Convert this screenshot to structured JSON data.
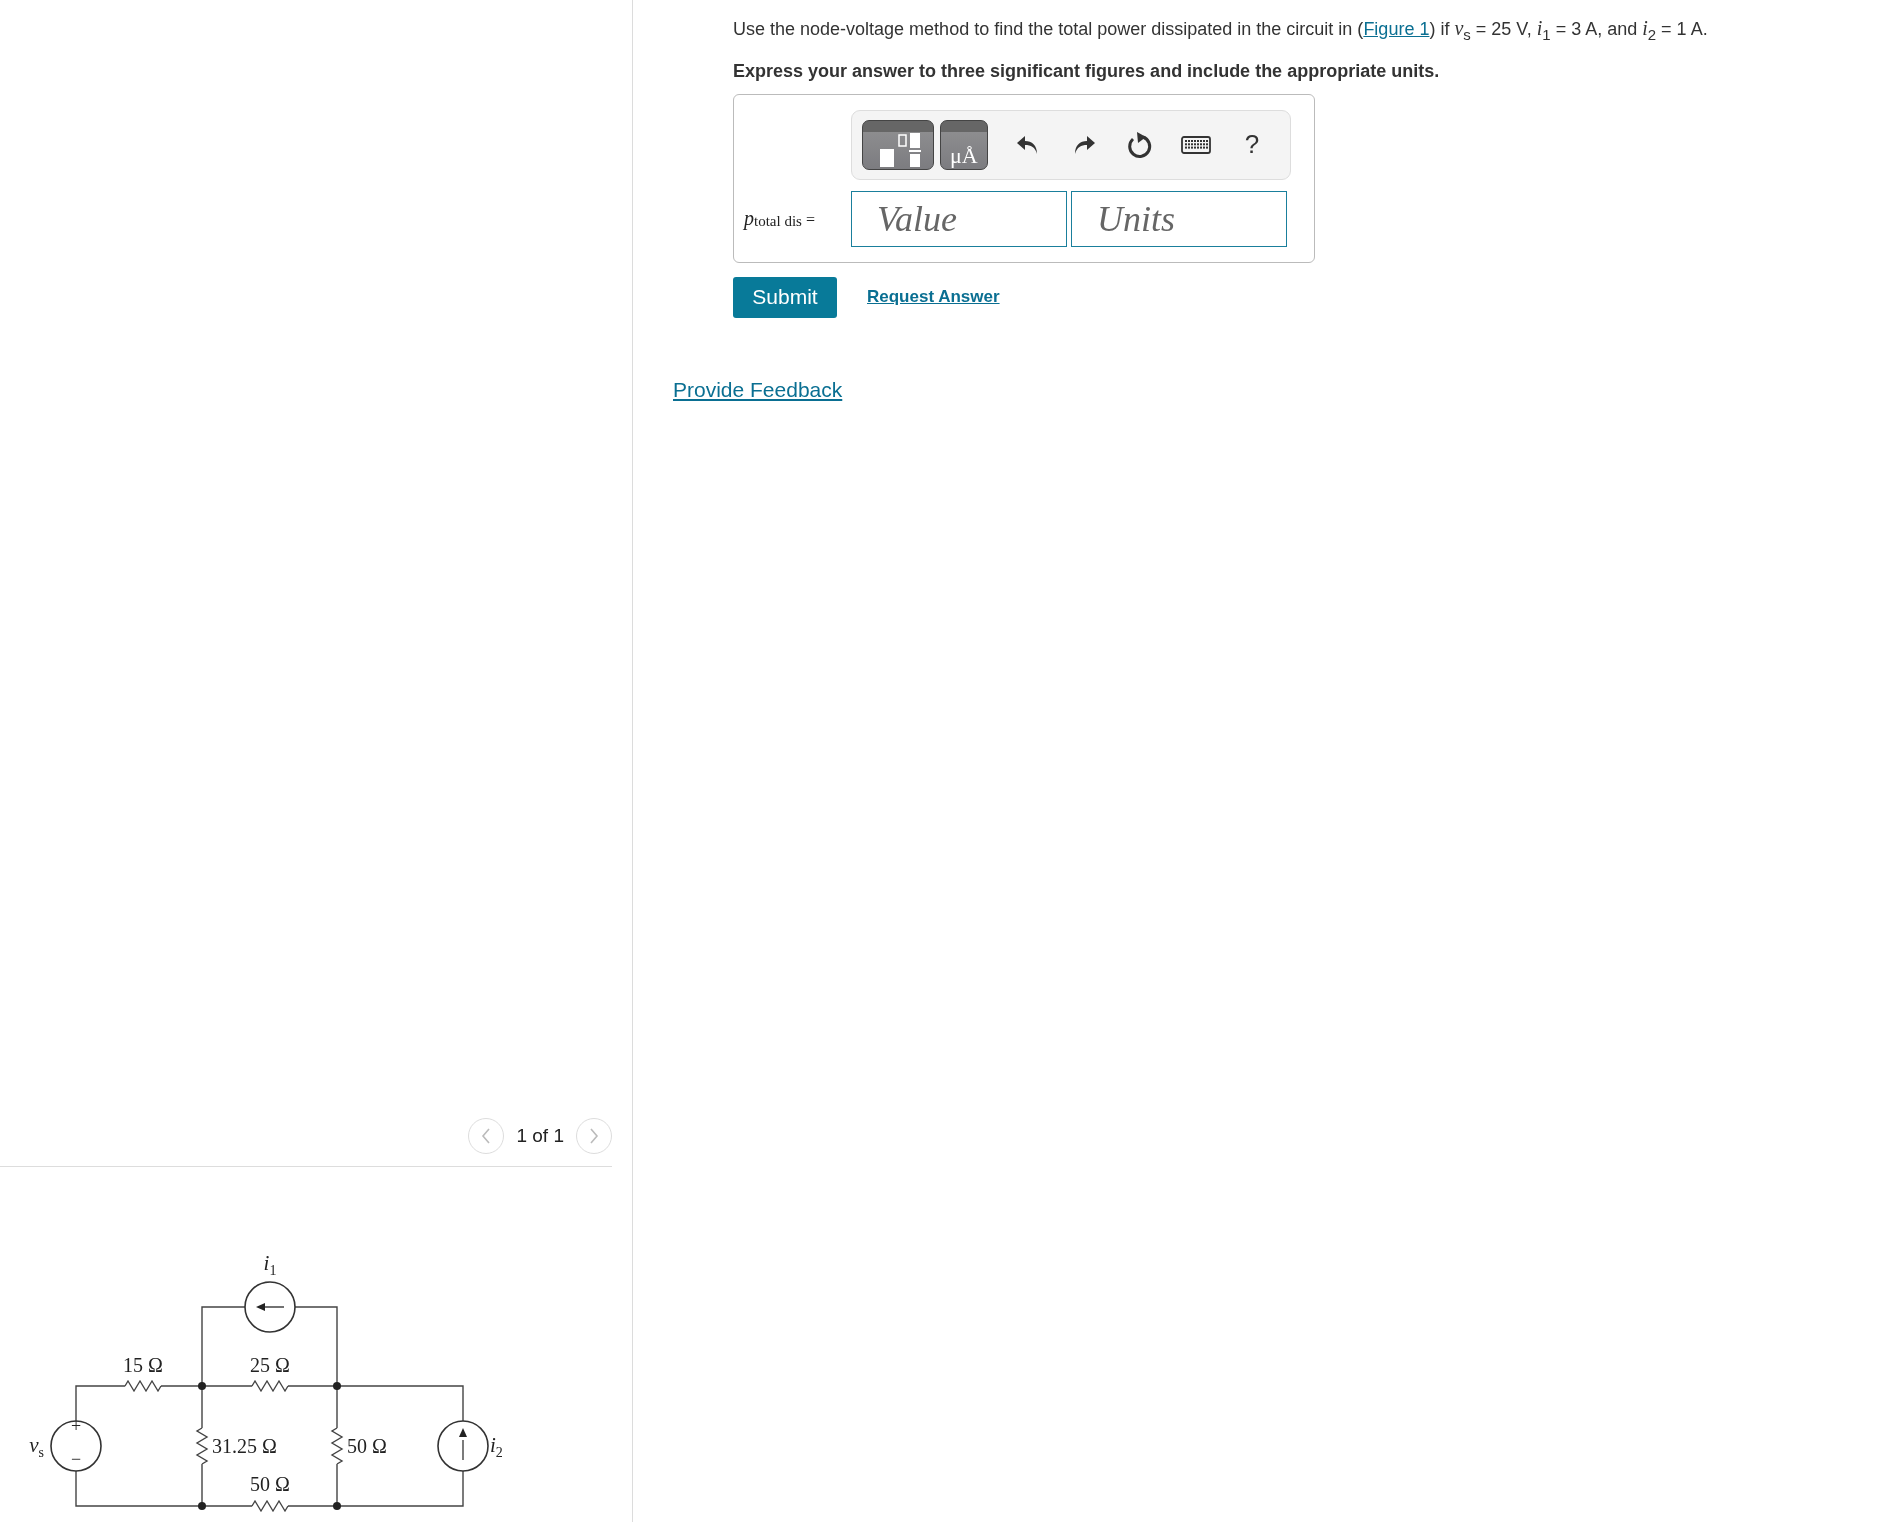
{
  "problem": {
    "text_before": "Use the node-voltage method to find the total power dissipated in the circuit in (",
    "figure_link": "Figure 1",
    "text_after": ") if *v*$_{s}$ = 25 V, *i*$_{1}$ = 3 A, and *i*$_{2}$ = 1 A.",
    "instruction": "Express your answer to three significant figures and include the appropriate units."
  },
  "answer": {
    "toolbar": [
      {
        "kind": "templates"
      },
      {
        "kind": "units",
        "glyph": "μÅ"
      },
      {
        "kind": "undo"
      },
      {
        "kind": "redo"
      },
      {
        "kind": "reset"
      },
      {
        "kind": "keyboard"
      },
      {
        "kind": "help",
        "glyph": "?"
      }
    ],
    "label": "*p*$_{total dis}$ =",
    "value": {
      "placeholder": "Value"
    },
    "units": {
      "placeholder": "Units"
    }
  },
  "actions": {
    "submit": "Submit",
    "request": "Request Answer"
  },
  "feedback_link": "Provide Feedback",
  "figure": {
    "pager": {
      "prev_disabled": true,
      "text": "1 of 1",
      "next_disabled": true
    },
    "circuit": {
      "resistors": [
        "15 Ω",
        "25 Ω",
        "31.25 Ω",
        "50 Ω",
        "50 Ω"
      ],
      "sources": [
        {
          "symbol": "v",
          "subscript": "s"
        },
        {
          "symbol": "i",
          "subscript": "1"
        },
        {
          "symbol": "i",
          "subscript": "2"
        }
      ],
      "polarity": [
        "+",
        "−"
      ]
    }
  }
}
